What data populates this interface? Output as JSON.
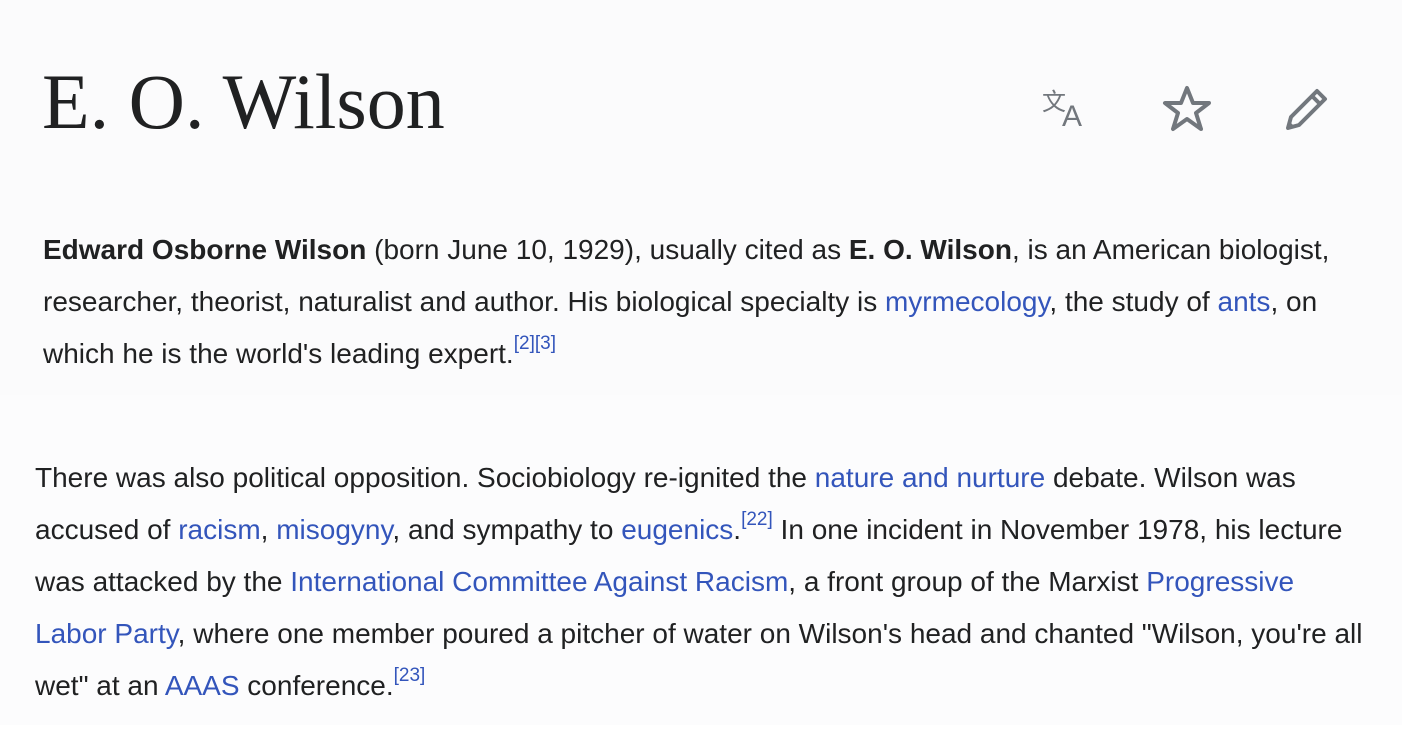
{
  "header": {
    "title": "E. O. Wilson",
    "icons": {
      "language": "language-icon",
      "watch": "star-icon",
      "edit": "pencil-icon"
    }
  },
  "lead": {
    "bold_name": "Edward Osborne Wilson",
    "text_1": " (born June 10, 1929), usually cited as ",
    "bold_short": "E. O. Wilson",
    "text_2": ", is an American biologist, researcher, theorist, naturalist and author. His biological specialty is ",
    "link_myrmecology": "myrmecology",
    "text_3": ", the study of ",
    "link_ants": "ants",
    "text_4": ", on which he is the world's leading expert.",
    "ref_2": "[2]",
    "ref_3": "[3]"
  },
  "body": {
    "text_1": "There was also political opposition. Sociobiology re-ignited the ",
    "link_nature_nurture": "nature and nurture",
    "text_2": " debate. Wilson was accused of ",
    "link_racism": "racism",
    "text_3": ", ",
    "link_misogyny": "misogyny",
    "text_4": ", and sympathy to ",
    "link_eugenics": "eugenics",
    "text_5": ".",
    "ref_22": "[22]",
    "text_6": " In one incident in November 1978, his lecture was attacked by the ",
    "link_incar": "International Committee Against Racism",
    "text_7": ", a front group of the Marxist ",
    "link_plp": "Progressive Labor Party",
    "text_8": ", where one member poured a pitcher of water on Wilson's head and chanted \"Wilson, you're all wet\" at an ",
    "link_aaas": "AAAS",
    "text_9": " conference.",
    "ref_23": "[23]"
  },
  "colors": {
    "link": "#3355bb",
    "text": "#202122",
    "icon": "#72777d",
    "panel_bg": "#fbfbfc"
  }
}
